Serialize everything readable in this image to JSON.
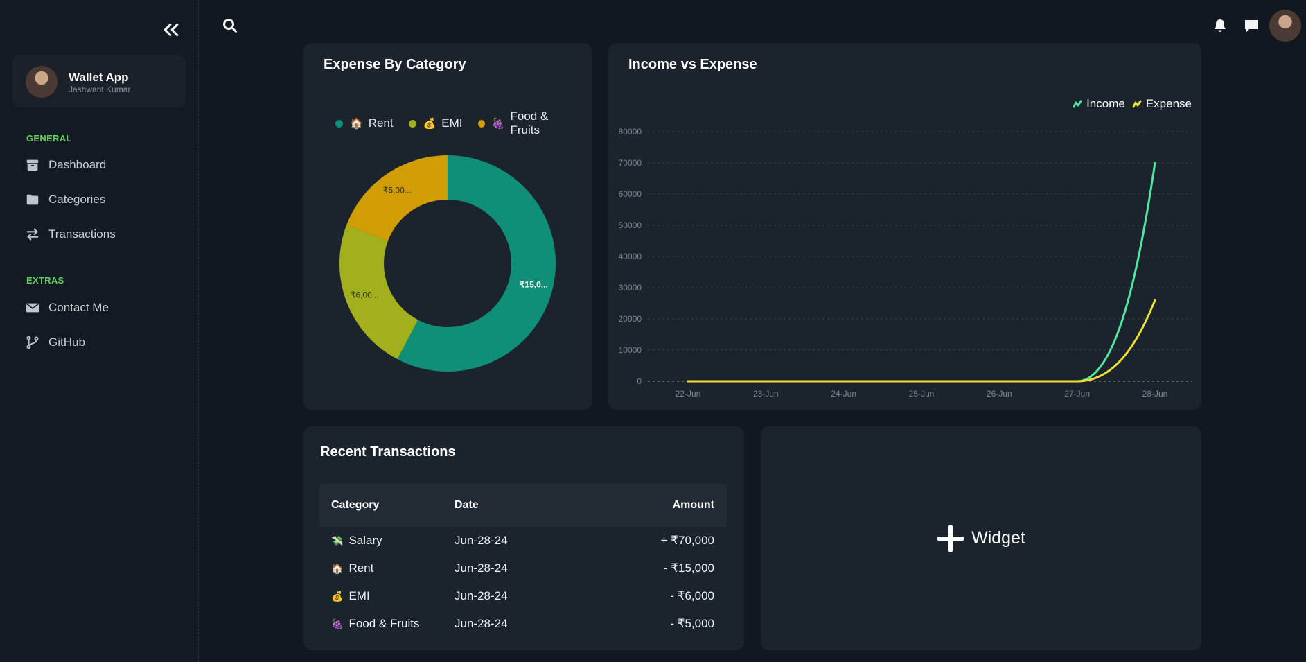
{
  "sidebar": {
    "profile": {
      "name": "Wallet App",
      "subtitle": "Jashwant Kumar"
    },
    "sections": [
      {
        "label": "GENERAL"
      },
      {
        "label": "EXTRAS"
      }
    ],
    "items": [
      {
        "label": "Dashboard",
        "icon": "box-icon"
      },
      {
        "label": "Categories",
        "icon": "folder-icon"
      },
      {
        "label": "Transactions",
        "icon": "swap-icon"
      },
      {
        "label": "Contact Me",
        "icon": "mail-icon"
      },
      {
        "label": "GitHub",
        "icon": "git-branch-icon"
      }
    ]
  },
  "colors": {
    "accent_green": "#5fd35b",
    "rent": "#0f8f78",
    "emi": "#a2b01b",
    "food": "#d19d04",
    "income": "#4ee8a0",
    "expense": "#f0e034"
  },
  "expense_card": {
    "title": "Expense By Category",
    "legend": [
      {
        "emoji": "🏠",
        "label": "Rent"
      },
      {
        "emoji": "💰",
        "label": "EMI"
      },
      {
        "emoji": "🍇",
        "label": "Food & Fruits"
      }
    ],
    "slice_labels": [
      "₹15,0...",
      "₹6,00...",
      "₹5,00..."
    ]
  },
  "income_card": {
    "title": "Income vs Expense",
    "legend": {
      "income": "Income",
      "expense": "Expense"
    }
  },
  "chart_data": {
    "type": "line",
    "title": "Income vs Expense",
    "x": [
      "22-Jun",
      "23-Jun",
      "24-Jun",
      "25-Jun",
      "26-Jun",
      "27-Jun",
      "28-Jun"
    ],
    "ylim": [
      0,
      80000
    ],
    "yticks": [
      "0",
      "10000",
      "20000",
      "30000",
      "40000",
      "50000",
      "60000",
      "70000",
      "80000"
    ],
    "grid": true,
    "legend_position": "top-right",
    "series": [
      {
        "name": "Income",
        "values": [
          0,
          0,
          0,
          0,
          0,
          0,
          70000
        ]
      },
      {
        "name": "Expense",
        "values": [
          0,
          0,
          0,
          0,
          0,
          0,
          26000
        ]
      }
    ]
  },
  "pie_data": {
    "type": "pie",
    "title": "Expense By Category",
    "categories": [
      "Rent",
      "EMI",
      "Food & Fruits"
    ],
    "values": [
      15000,
      6000,
      5000
    ]
  },
  "transactions": {
    "title": "Recent Transactions",
    "headers": {
      "category": "Category",
      "date": "Date",
      "amount": "Amount"
    },
    "rows": [
      {
        "emoji": "💸",
        "category": "Salary",
        "date": "Jun-28-24",
        "amount": "+ ₹70,000"
      },
      {
        "emoji": "🏠",
        "category": "Rent",
        "date": "Jun-28-24",
        "amount": "- ₹15,000"
      },
      {
        "emoji": "💰",
        "category": "EMI",
        "date": "Jun-28-24",
        "amount": "- ₹6,000"
      },
      {
        "emoji": "🍇",
        "category": "Food & Fruits",
        "date": "Jun-28-24",
        "amount": "- ₹5,000"
      }
    ]
  },
  "widget": {
    "label": "Widget"
  }
}
